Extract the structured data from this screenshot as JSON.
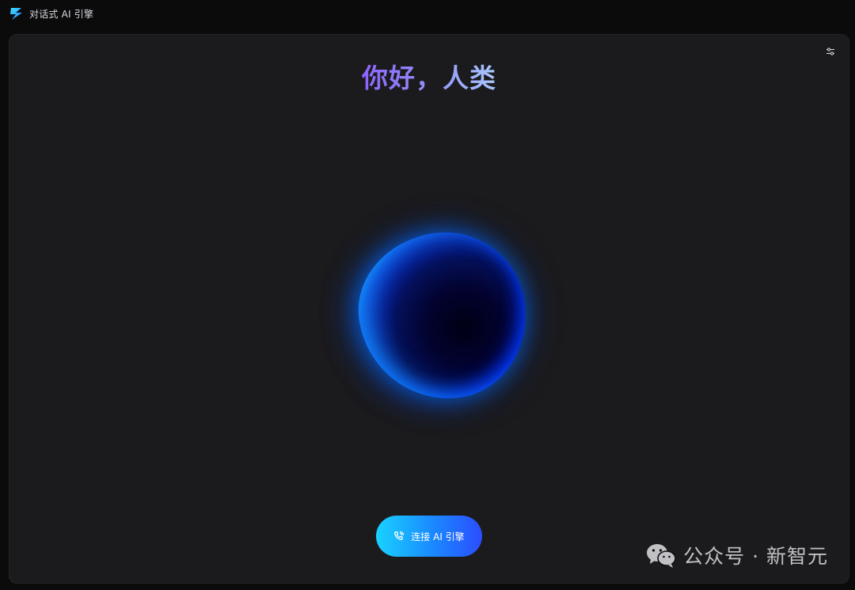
{
  "app": {
    "title": "对话式 AI 引擎",
    "logo_icon": "lightning-logo-icon"
  },
  "header": {
    "greeting": "你好，人类"
  },
  "toolbar": {
    "settings_icon": "sliders-icon"
  },
  "orb": {
    "state": "idle",
    "colors": [
      "#1dc3ff",
      "#0a2fd4",
      "#000014"
    ]
  },
  "connect": {
    "label": "连接 AI 引擎",
    "icon": "phone-call-icon"
  },
  "watermark": {
    "text": "公众号 · 新智元",
    "icon": "wechat-icon"
  },
  "colors": {
    "background": "#0b0b0c",
    "panel": "#1b1b1d",
    "accent_start": "#19d2ff",
    "accent_end": "#2b4dff",
    "greeting_gradient": [
      "#8f63ff",
      "#a9c8ff"
    ]
  }
}
